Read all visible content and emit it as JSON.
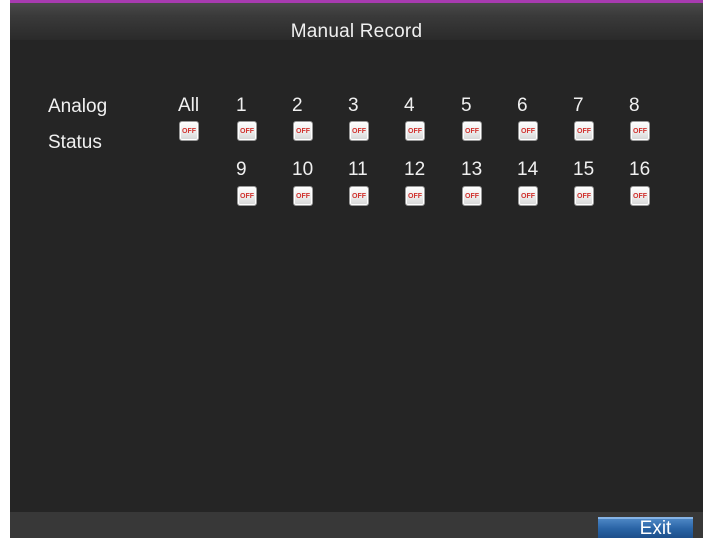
{
  "window": {
    "title": "Manual Record"
  },
  "labels": {
    "analog": "Analog",
    "status": "Status",
    "all": "All"
  },
  "all_button": {
    "state": "OFF"
  },
  "channels": [
    {
      "number": "1",
      "state": "OFF"
    },
    {
      "number": "2",
      "state": "OFF"
    },
    {
      "number": "3",
      "state": "OFF"
    },
    {
      "number": "4",
      "state": "OFF"
    },
    {
      "number": "5",
      "state": "OFF"
    },
    {
      "number": "6",
      "state": "OFF"
    },
    {
      "number": "7",
      "state": "OFF"
    },
    {
      "number": "8",
      "state": "OFF"
    },
    {
      "number": "9",
      "state": "OFF"
    },
    {
      "number": "10",
      "state": "OFF"
    },
    {
      "number": "11",
      "state": "OFF"
    },
    {
      "number": "12",
      "state": "OFF"
    },
    {
      "number": "13",
      "state": "OFF"
    },
    {
      "number": "14",
      "state": "OFF"
    },
    {
      "number": "15",
      "state": "OFF"
    },
    {
      "number": "16",
      "state": "OFF"
    }
  ],
  "footer": {
    "exit_label": "Exit"
  },
  "colors": {
    "accent": "#a83bb0",
    "off_text": "#d0312d",
    "exit_button": "#2a64a6"
  }
}
